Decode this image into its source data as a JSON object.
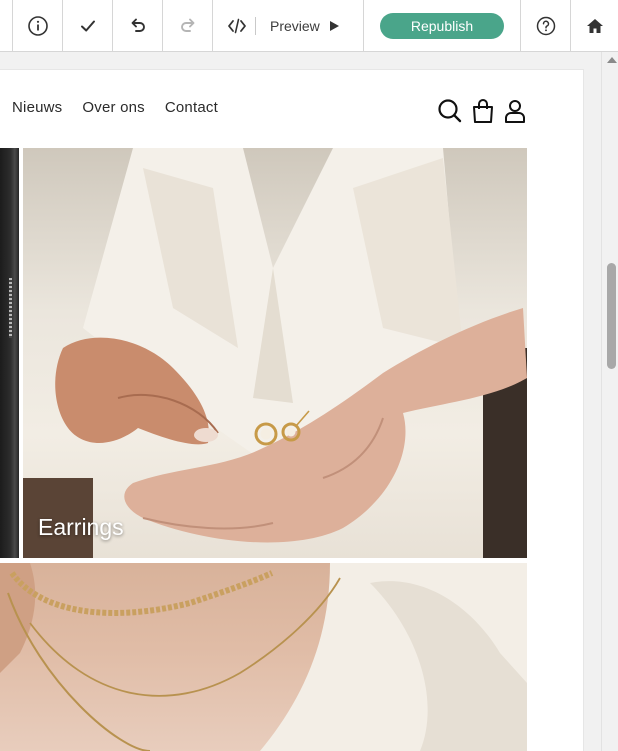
{
  "toolbar": {
    "info_icon": "info-circle-icon",
    "check_icon": "checkmark-icon",
    "undo_icon": "undo-icon",
    "redo_icon": "redo-icon",
    "code_icon": "code-icon",
    "preview_label": "Preview",
    "republish_label": "Republish",
    "help_icon": "question-circle-icon",
    "home_icon": "home-icon",
    "accent_color": "#4aa58a"
  },
  "site": {
    "nav": {
      "items": [
        "Nieuws",
        "Over ons",
        "Contact"
      ]
    },
    "nav_icons": [
      "search-icon",
      "shopping-bag-icon",
      "user-icon"
    ],
    "tiles": [
      {
        "label": "Earrings"
      }
    ]
  }
}
